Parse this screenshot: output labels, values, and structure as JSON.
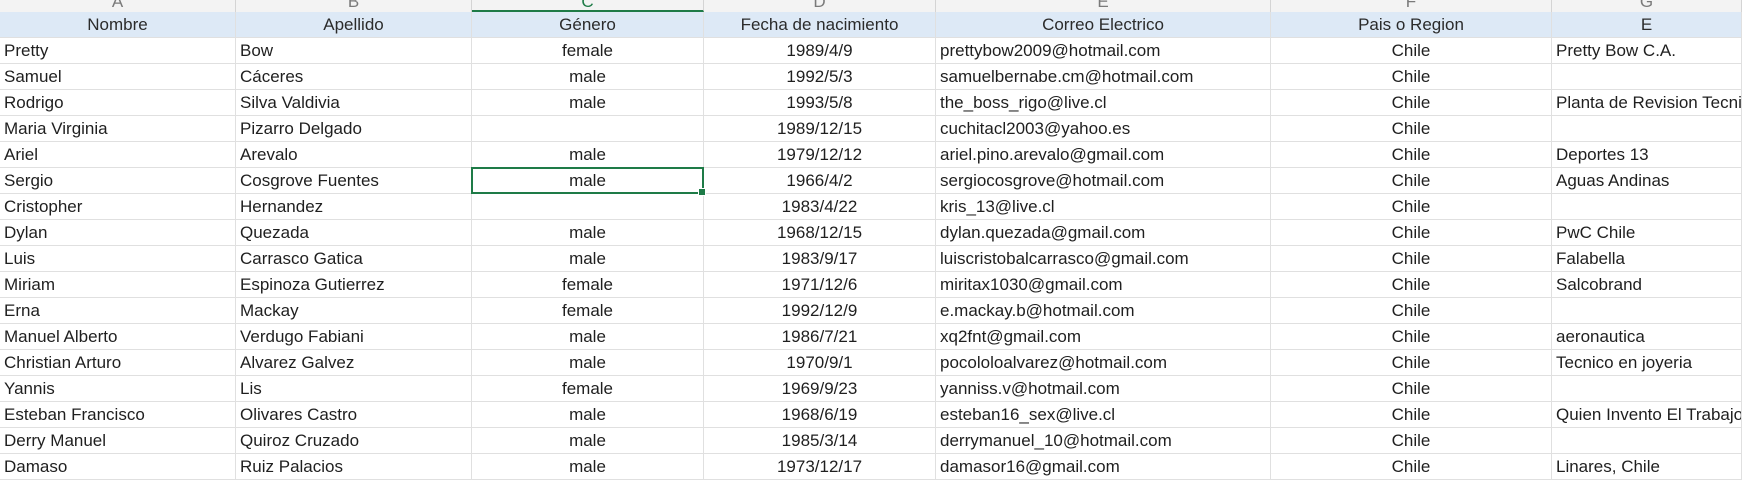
{
  "column_letters": [
    "A",
    "B",
    "C",
    "D",
    "E",
    "F",
    "G"
  ],
  "selected_column": "C",
  "headers": [
    "Nombre",
    "Apellido",
    "Género",
    "Fecha de nacimiento",
    "Correo Electrico",
    "Pais o Region",
    "E"
  ],
  "rows": [
    [
      "Pretty",
      "Bow",
      "female",
      "1989/4/9",
      "prettybow2009@hotmail.com",
      "Chile",
      "Pretty Bow C.A."
    ],
    [
      "Samuel",
      "Cáceres",
      "male",
      "1992/5/3",
      "samuelbernabe.cm@hotmail.com",
      "Chile",
      ""
    ],
    [
      "Rodrigo",
      "Silva Valdivia",
      "male",
      "1993/5/8",
      "the_boss_rigo@live.cl",
      "Chile",
      "Planta de Revision Tecnica"
    ],
    [
      "Maria Virginia",
      "Pizarro Delgado",
      "",
      "1989/12/15",
      "cuchitacl2003@yahoo.es",
      "Chile",
      ""
    ],
    [
      "Ariel",
      "Arevalo",
      "male",
      "1979/12/12",
      "ariel.pino.arevalo@gmail.com",
      "Chile",
      "Deportes 13"
    ],
    [
      "Sergio",
      "Cosgrove Fuentes",
      "male",
      "1966/4/2",
      "sergiocosgrove@hotmail.com",
      "Chile",
      "Aguas Andinas"
    ],
    [
      "Cristopher",
      "Hernandez",
      "",
      "1983/4/22",
      "kris_13@live.cl",
      "Chile",
      ""
    ],
    [
      "Dylan",
      "Quezada",
      "male",
      "1968/12/15",
      "dylan.quezada@gmail.com",
      "Chile",
      "PwC Chile"
    ],
    [
      "Luis",
      "Carrasco Gatica",
      "male",
      "1983/9/17",
      "luiscristobalcarrasco@gmail.com",
      "Chile",
      "Falabella"
    ],
    [
      "Miriam",
      "Espinoza Gutierrez",
      "female",
      "1971/12/6",
      "miritax1030@gmail.com",
      "Chile",
      "Salcobrand"
    ],
    [
      "Erna",
      "Mackay",
      "female",
      "1992/12/9",
      "e.mackay.b@hotmail.com",
      "Chile",
      ""
    ],
    [
      "Manuel Alberto",
      "Verdugo Fabiani",
      "male",
      "1986/7/21",
      "xq2fnt@gmail.com",
      "Chile",
      "aeronautica"
    ],
    [
      "Christian Arturo",
      "Alvarez Galvez",
      "male",
      "1970/9/1",
      "pocololoalvarez@hotmail.com",
      "Chile",
      "Tecnico en joyeria"
    ],
    [
      "Yannis",
      "Lis",
      "female",
      "1969/9/23",
      "yanniss.v@hotmail.com",
      "Chile",
      ""
    ],
    [
      "Esteban Francisco",
      "Olivares Castro",
      "male",
      "1968/6/19",
      "esteban16_sex@live.cl",
      "Chile",
      "Quien Invento El Trabajo? N"
    ],
    [
      "Derry Manuel",
      "Quiroz Cruzado",
      "male",
      "1985/3/14",
      "derrymanuel_10@hotmail.com",
      "Chile",
      ""
    ],
    [
      "Damaso",
      "Ruiz Palacios",
      "male",
      "1973/12/17",
      "damasor16@gmail.com",
      "Chile",
      "Linares, Chile"
    ]
  ],
  "colors": {
    "header_fill": "#dde9f6",
    "selection": "#1e7b47",
    "gridline": "#e0e0e0"
  }
}
